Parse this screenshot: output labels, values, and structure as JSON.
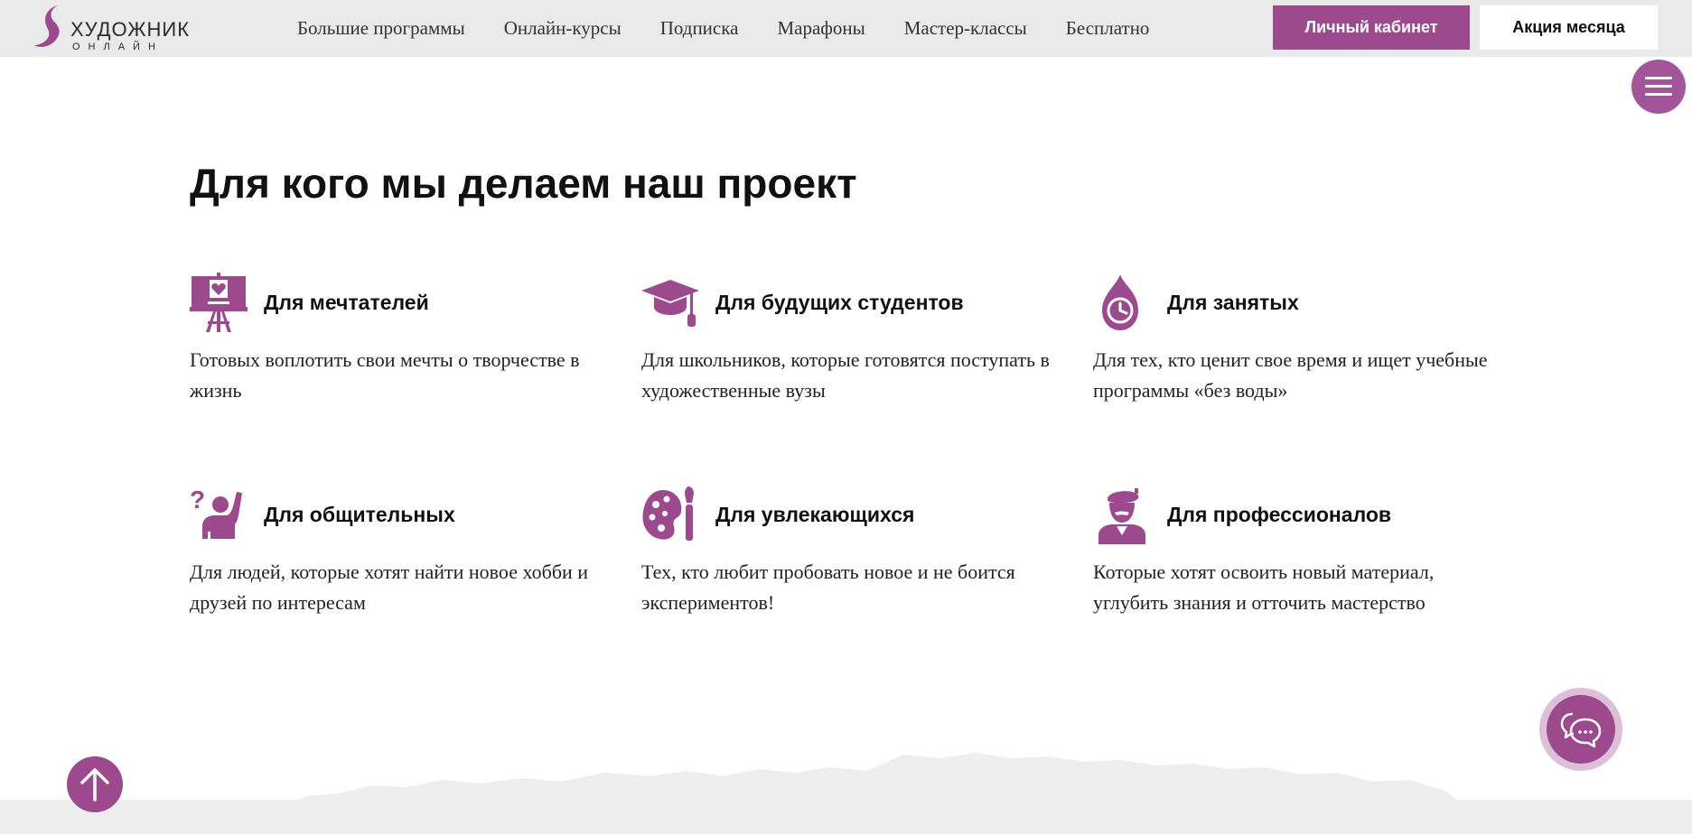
{
  "header": {
    "logo_name": "ХУДОЖНИК",
    "logo_sub": "ОНЛАЙН",
    "nav": [
      {
        "label": "Большие программы"
      },
      {
        "label": "Онлайн-курсы"
      },
      {
        "label": "Подписка"
      },
      {
        "label": "Марафоны"
      },
      {
        "label": "Мастер-классы"
      },
      {
        "label": "Бесплатно"
      }
    ],
    "cabinet_label": "Личный кабинет",
    "promo_label": "Акция месяца"
  },
  "section": {
    "title": "Для кого мы делаем наш проект",
    "cards": [
      {
        "icon": "easel-heart-icon",
        "title": "Для мечтателей",
        "text": "Готовых воплотить свои мечты о творчестве в жизнь"
      },
      {
        "icon": "graduation-cap-icon",
        "title": "Для будущих студентов",
        "text": "Для школьников, которые готовятся поступать в художественные вузы"
      },
      {
        "icon": "drop-clock-icon",
        "title": "Для занятых",
        "text": "Для тех, кто ценит свое время и ищет учебные программы «без воды»"
      },
      {
        "icon": "person-question-icon",
        "title": "Для общительных",
        "text": "Для людей, которые хотят найти новое хобби и друзей по интересам"
      },
      {
        "icon": "palette-brush-icon",
        "title": "Для увлекающихся",
        "text": "Тех, кто любит пробовать новое и не боится экспериментов!"
      },
      {
        "icon": "artist-beret-icon",
        "title": "Для профессионалов",
        "text": "Которые хотят освоить новый материал, углубить знания и отточить мастерство"
      }
    ]
  },
  "colors": {
    "accent": "#9c4a8d",
    "header_bg": "#eaeaea",
    "chat_ring": "#dcc0d7"
  }
}
